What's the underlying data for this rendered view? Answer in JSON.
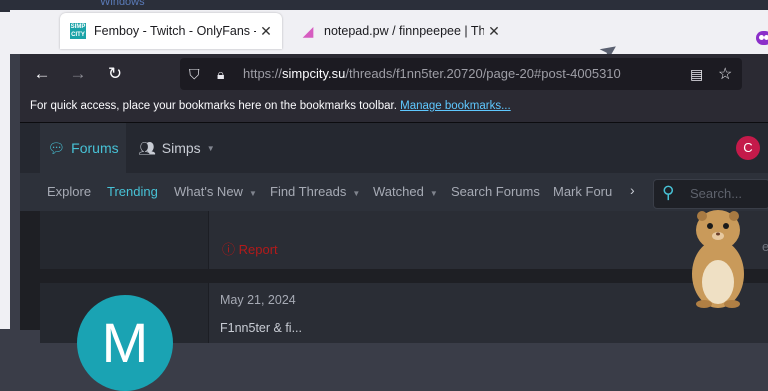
{
  "desktop": {
    "label": "Windows"
  },
  "tabs": [
    {
      "title": "Femboy - Twitch - OnlyFans - F",
      "favicon": "simpcity-icon",
      "active": true
    },
    {
      "title": "notepad.pw / finnpeepee | The",
      "favicon": "notepad-icon",
      "active": false
    }
  ],
  "toolbar": {
    "url_scheme": "https://",
    "url_host": "simpcity.su",
    "url_path": "/threads/f1nn5ter.20720/page-20#post-4005310"
  },
  "bookmarks": {
    "text": "For quick access, place your bookmarks here on the bookmarks toolbar.",
    "link": "Manage bookmarks..."
  },
  "site": {
    "nav": {
      "forums": "Forums",
      "simps": "Simps"
    },
    "user_avatar": "C",
    "subnav": [
      "Explore",
      "Trending",
      "What's New",
      "Find Threads",
      "Watched",
      "Search Forums",
      "Mark Foru"
    ],
    "search_placeholder": "Search...",
    "post1": {
      "report": "Report",
      "right_text": "e"
    },
    "post2": {
      "avatar_letter": "M",
      "date": "May 21, 2024",
      "text": "F1nn5ter & fi..."
    }
  },
  "colors": {
    "accent": "#47c2d6",
    "report": "#b31a1a",
    "avatar_c": "#c41a4a",
    "avatar_m": "#1aa3b3"
  }
}
